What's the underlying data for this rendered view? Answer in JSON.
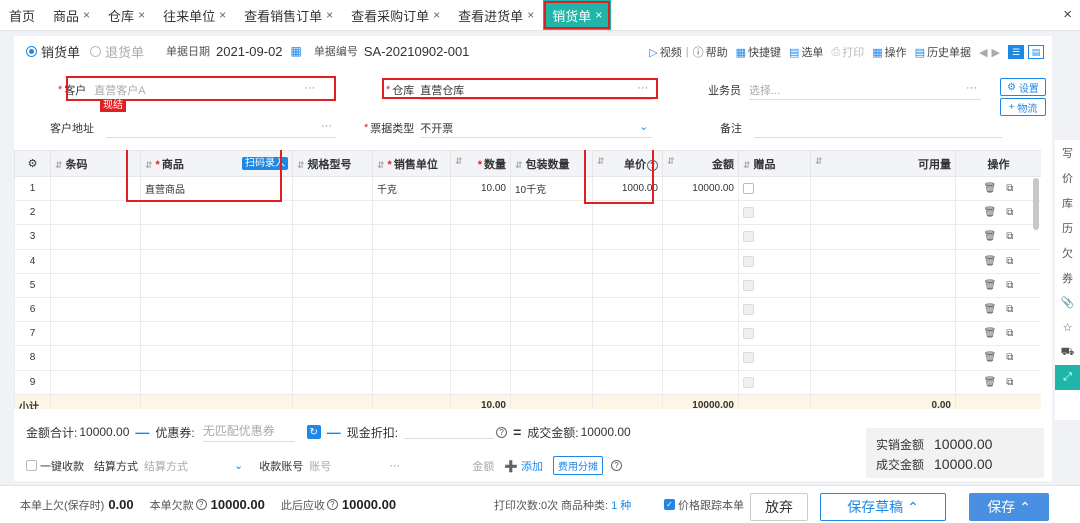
{
  "tabs": [
    {
      "label": "首页",
      "closable": false
    },
    {
      "label": "商品",
      "closable": true
    },
    {
      "label": "仓库",
      "closable": true
    },
    {
      "label": "往来单位",
      "closable": true
    },
    {
      "label": "查看销售订单",
      "closable": true
    },
    {
      "label": "查看采购订单",
      "closable": true
    },
    {
      "label": "查看进货单",
      "closable": true
    },
    {
      "label": "销货单",
      "closable": true,
      "active": true
    }
  ],
  "close_glyph": "×",
  "header": {
    "type_sales": "销货单",
    "type_return": "退货单",
    "date_label": "单据日期",
    "date_value": "2021-09-02",
    "number_label": "单据编号",
    "number_value": "SA-20210902-001",
    "toolbar": {
      "video": "视频",
      "help": "帮助",
      "shortcut": "快捷键",
      "select": "选单",
      "print": "打印",
      "operation": "操作",
      "history": "历史单据"
    }
  },
  "form": {
    "customer_label": "客户",
    "customer_placeholder": "直营客户A",
    "cash_badge": "现结",
    "warehouse_label": "仓库",
    "warehouse_value": "直营仓库",
    "salesperson_label": "业务员",
    "salesperson_placeholder": "选择...",
    "settings_button": "设置",
    "logistics_button": "物流",
    "address_label": "客户地址",
    "invoice_label": "票据类型",
    "invoice_value": "不开票",
    "remark_label": "备注",
    "ellipsis": "···"
  },
  "table": {
    "columns": {
      "barcode": "条码",
      "product": "商品",
      "scan_button": "扫码录入",
      "spec": "规格型号",
      "unit": "销售单位",
      "qty": "数量",
      "package_qty": "包装数量",
      "unit_price": "单价",
      "amount": "金额",
      "gift": "赠品",
      "available": "可用量",
      "ops": "操作"
    },
    "rows": [
      {
        "no": "1",
        "product": "直营商品",
        "unit": "千克",
        "qty": "10.00",
        "package_qty": "10千克",
        "price": "1000.00",
        "amount": "10000.00"
      },
      {
        "no": "2",
        "product": "",
        "unit": "",
        "qty": "",
        "package_qty": "",
        "price": "",
        "amount": ""
      },
      {
        "no": "3",
        "product": "",
        "unit": "",
        "qty": "",
        "package_qty": "",
        "price": "",
        "amount": ""
      },
      {
        "no": "4",
        "product": "",
        "unit": "",
        "qty": "",
        "package_qty": "",
        "price": "",
        "amount": ""
      },
      {
        "no": "5",
        "product": "",
        "unit": "",
        "qty": "",
        "package_qty": "",
        "price": "",
        "amount": ""
      },
      {
        "no": "6",
        "product": "",
        "unit": "",
        "qty": "",
        "package_qty": "",
        "price": "",
        "amount": ""
      },
      {
        "no": "7",
        "product": "",
        "unit": "",
        "qty": "",
        "package_qty": "",
        "price": "",
        "amount": ""
      },
      {
        "no": "8",
        "product": "",
        "unit": "",
        "qty": "",
        "package_qty": "",
        "price": "",
        "amount": ""
      },
      {
        "no": "9",
        "product": "",
        "unit": "",
        "qty": "",
        "package_qty": "",
        "price": "",
        "amount": ""
      }
    ],
    "subtotal_label": "小计",
    "subtotal_qty": "10.00",
    "subtotal_amount": "10000.00",
    "subtotal_available": "0.00"
  },
  "summary": {
    "total_label": "金额合计:",
    "total_value": "10000.00",
    "coupon_label": "优惠券:",
    "coupon_placeholder": "无匹配优惠券",
    "discount_label": "现金折扣:",
    "deal_label": "成交金额:",
    "deal_value": "10000.00",
    "one_click": "一键收款",
    "settle_method_label": "结算方式",
    "settle_method_placeholder": "结算方式",
    "account_label": "收款账号",
    "account_placeholder": "账号",
    "amount_label": "金额",
    "add_link": "添加",
    "fee_button": "费用分摊",
    "actual_label": "实销金额",
    "actual_value": "10000.00",
    "deal2_label": "成交金额",
    "deal2_value": "10000.00"
  },
  "bottombar": {
    "prev_owed_label": "本单上欠(保存时)",
    "prev_owed_value": "0.00",
    "owed_label": "本单欠款",
    "owed_value": "10000.00",
    "after_label": "此后应收",
    "after_value": "10000.00",
    "print_count": "打印次数:0次",
    "product_kinds_label": "商品种类:",
    "product_kinds_value": "1 种",
    "price_track": "价格跟踪本单",
    "discard": "放弃",
    "save_draft": "保存草稿",
    "save": "保存"
  },
  "sidebar_icons": [
    "写",
    "价",
    "库",
    "历",
    "欠",
    "券"
  ],
  "colors": {
    "accent": "#1e88e5",
    "active_tab": "#1fb5a8",
    "highlight_box": "#e02020"
  }
}
